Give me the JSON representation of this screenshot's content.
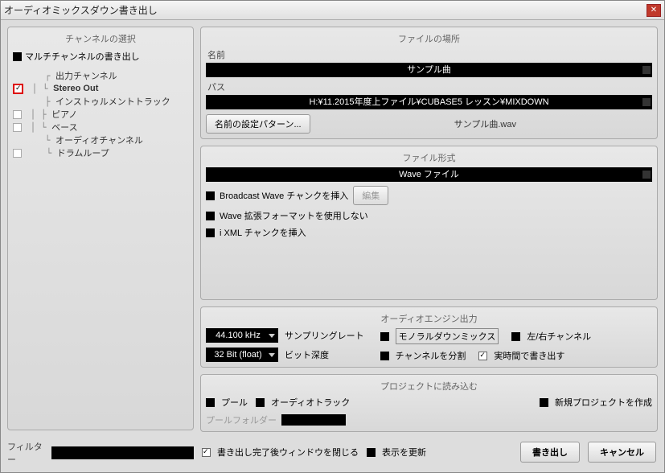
{
  "title": "オーディオミックスダウン書き出し",
  "leftPanel": {
    "title": "チャンネルの選択",
    "multiExport": "マルチチャンネルの書き出し",
    "tree": {
      "outputChannel": "出力チャンネル",
      "stereoOut": "Stereo Out",
      "instrumentTrack": "インストゥルメントトラック",
      "piano": "ピアノ",
      "bass": "ベース",
      "audioChannel": "オーディオチャンネル",
      "drumLoop": "ドラムループ"
    },
    "filter": "フィルター"
  },
  "fileLocation": {
    "title": "ファイルの場所",
    "nameLabel": "名前",
    "nameValue": "サンプル曲",
    "pathLabel": "パス",
    "pathValue": "H:¥11.2015年度上ファイル¥CUBASE5 レッスン¥MIXDOWN",
    "patternBtn": "名前の設定パターン...",
    "fileName": "サンプル曲.wav"
  },
  "fileFormat": {
    "title": "ファイル形式",
    "typeValue": "Wave ファイル",
    "broadcastWave": "Broadcast Wave チャンクを挿入",
    "editBtn": "編集",
    "waveExt": "Wave 拡張フォーマットを使用しない",
    "ixml": "i XML チャンクを挿入"
  },
  "audioEngine": {
    "title": "オーディオエンジン出力",
    "sampleRate": "44.100 kHz",
    "sampleRateLabel": "サンプリングレート",
    "bitDepth": "32 Bit (float)",
    "bitDepthLabel": "ビット深度",
    "monoDownmix": "モノラルダウンミックス",
    "lrChannel": "左/右チャンネル",
    "splitChannel": "チャンネルを分割",
    "realtime": "実時間で書き出す"
  },
  "importProject": {
    "title": "プロジェクトに読み込む",
    "pool": "プール",
    "audioTrack": "オーディオトラック",
    "newProject": "新規プロジェクトを作成",
    "poolFolder": "プールフォルダー"
  },
  "bottom": {
    "closeAfter": "書き出し完了後ウィンドウを閉じる",
    "updateDisplay": "表示を更新",
    "export": "書き出し",
    "cancel": "キャンセル"
  }
}
